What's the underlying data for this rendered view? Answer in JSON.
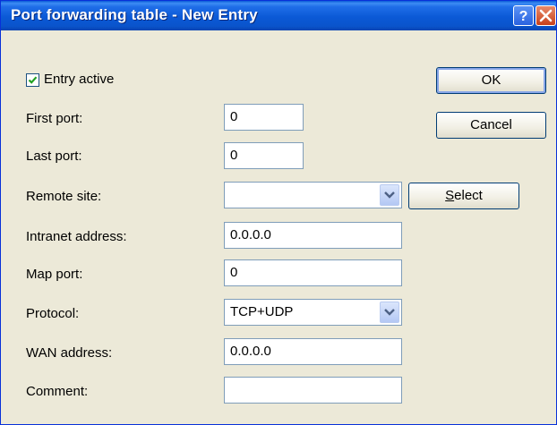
{
  "window": {
    "title": "Port forwarding table - New Entry"
  },
  "titlebar": {
    "help_icon": "question-mark-icon",
    "close_icon": "close-x-icon"
  },
  "form": {
    "entry_active": {
      "label": "Entry active",
      "checked": true
    },
    "first_port": {
      "label": "First port:",
      "value": "0"
    },
    "last_port": {
      "label": "Last port:",
      "value": "0"
    },
    "remote_site": {
      "label": "Remote site:",
      "value": ""
    },
    "intranet_address": {
      "label": "Intranet address:",
      "value": "0.0.0.0"
    },
    "map_port": {
      "label": "Map port:",
      "value": "0"
    },
    "protocol": {
      "label": "Protocol:",
      "value": "TCP+UDP"
    },
    "wan_address": {
      "label": "WAN address:",
      "value": "0.0.0.0"
    },
    "comment": {
      "label": "Comment:",
      "value": ""
    }
  },
  "buttons": {
    "ok": "OK",
    "cancel": "Cancel",
    "select_first": "S",
    "select_rest": "elect"
  },
  "colors": {
    "titlebar": "#0a5bd8",
    "dialog_bg": "#ece9d8",
    "check": "#21a121"
  }
}
